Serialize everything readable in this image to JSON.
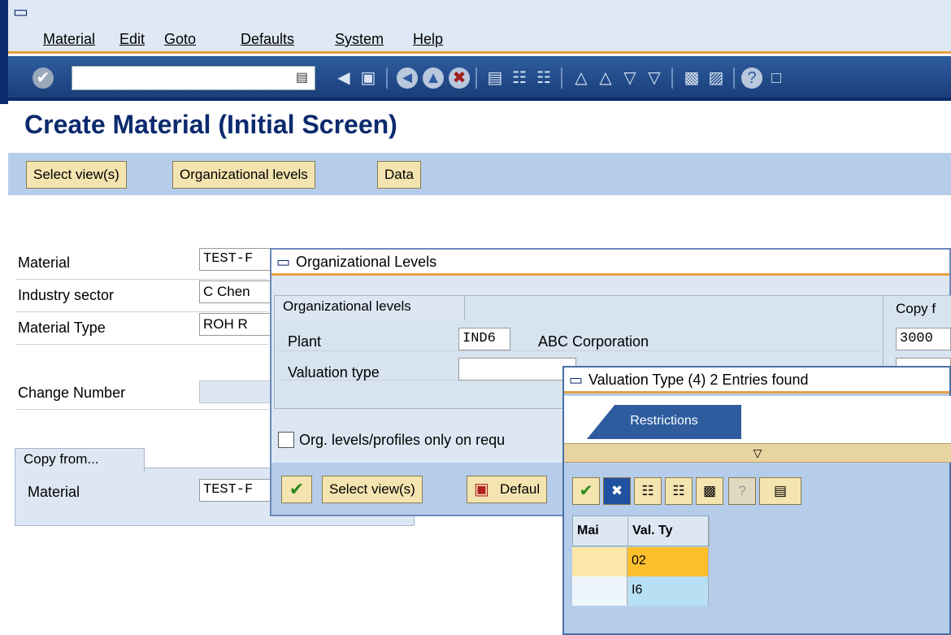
{
  "menu": {
    "items": [
      {
        "label": "Material"
      },
      {
        "label": "Edit"
      },
      {
        "label": "Goto"
      },
      {
        "label": "Defaults"
      },
      {
        "label": "System"
      },
      {
        "label": "Help"
      }
    ]
  },
  "page": {
    "title": "Create Material (Initial Screen)"
  },
  "appbar": {
    "buttons": [
      {
        "label": "Select view(s)"
      },
      {
        "label": "Organizational levels"
      },
      {
        "label": "Data"
      }
    ]
  },
  "form": {
    "material_label": "Material",
    "material_value": "TEST-F",
    "industry_label": "Industry sector",
    "industry_value": "C Chen",
    "type_label": "Material Type",
    "type_value": "ROH R",
    "change_label": "Change Number",
    "copy_group": "Copy from...",
    "copy_material_label": "Material",
    "copy_material_value": "TEST-F"
  },
  "org_dialog": {
    "title": "Organizational Levels",
    "group_title": "Organizational levels",
    "plant_label": "Plant",
    "plant_value": "IND6",
    "plant_desc": "ABC Corporation",
    "valuation_label": "Valuation type",
    "copy_group": "Copy f",
    "copy_value": "3000",
    "checkbox_label": "Org. levels/profiles only on requ",
    "select_views": "Select view(s)",
    "default": "Defaul"
  },
  "val_dialog": {
    "title": "Valuation Type (4)   2 Entries found",
    "tab_restrictions": "Restrictions",
    "col_main": "Mai",
    "col_valtype": "Val. Ty",
    "rows": [
      {
        "main": "",
        "valtype": "02"
      },
      {
        "main": "",
        "valtype": "I6"
      }
    ]
  }
}
